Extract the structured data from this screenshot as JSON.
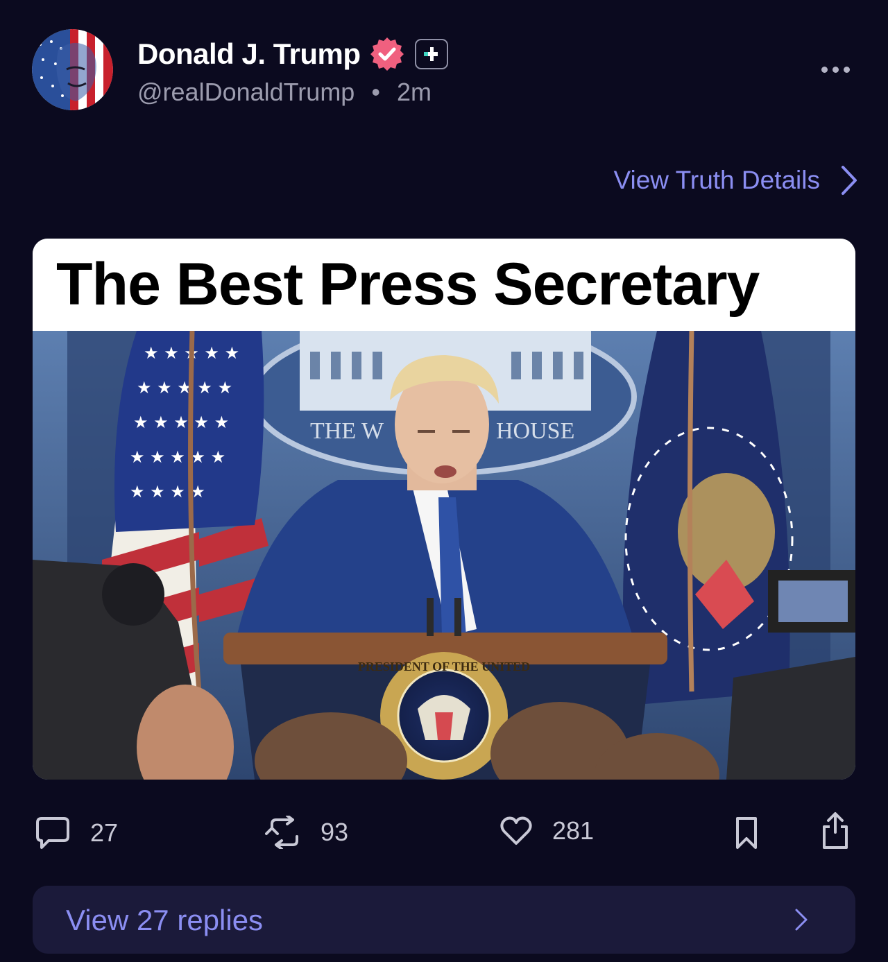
{
  "author": {
    "display_name": "Donald J. Trump",
    "handle": "@realDonaldTrump",
    "separator": "•",
    "time_ago": "2m",
    "verified_icon": "verified-badge-icon",
    "plus_icon": "plus-badge-icon"
  },
  "header": {
    "details_link_label": "View Truth Details",
    "more_icon": "more-options-icon"
  },
  "media": {
    "title_text": "The Best Press Secretary",
    "photo_description_icons": [
      "american-flag",
      "presidential-seal",
      "podium",
      "cameras"
    ],
    "seal_text": "SEAL OF THE PRESIDENT OF THE UNITED STATES",
    "backdrop_text": "THE WHITE HOUSE"
  },
  "actions": {
    "replies_count": "27",
    "retruths_count": "93",
    "likes_count": "281",
    "reply_icon": "comment-icon",
    "retruth_icon": "retruth-icon",
    "like_icon": "heart-icon",
    "bookmark_icon": "bookmark-icon",
    "share_icon": "share-icon"
  },
  "replies_bar": {
    "label": "View 27 replies"
  },
  "colors": {
    "background": "#0b0a1f",
    "accent_link": "#8b8ef2",
    "verified_pink": "#f0607f",
    "replies_bar_bg": "#1b1a3a"
  }
}
